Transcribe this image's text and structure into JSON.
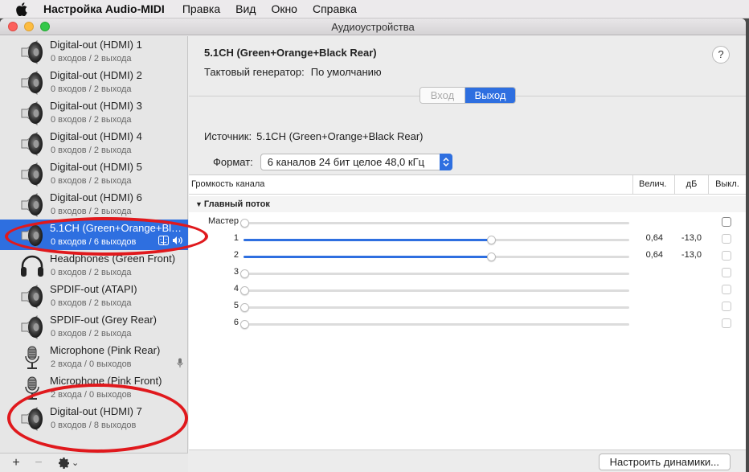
{
  "menubar": {
    "app": "Настройка Audio-MIDI",
    "items": [
      "Правка",
      "Вид",
      "Окно",
      "Справка"
    ]
  },
  "window": {
    "title": "Аудиоустройства"
  },
  "devices": [
    {
      "name": "Digital-out (HDMI) 1",
      "io": "0 входов / 2 выхода",
      "icon": "speaker-icon"
    },
    {
      "name": "Digital-out (HDMI) 2",
      "io": "0 входов / 2 выхода",
      "icon": "speaker-icon"
    },
    {
      "name": "Digital-out (HDMI) 3",
      "io": "0 входов / 2 выхода",
      "icon": "speaker-icon"
    },
    {
      "name": "Digital-out (HDMI) 4",
      "io": "0 входов / 2 выхода",
      "icon": "speaker-icon"
    },
    {
      "name": "Digital-out (HDMI) 5",
      "io": "0 входов / 2 выхода",
      "icon": "speaker-icon"
    },
    {
      "name": "Digital-out (HDMI) 6",
      "io": "0 входов / 2 выхода",
      "icon": "speaker-icon"
    },
    {
      "name": "5.1CH (Green+Orange+Black Rear)",
      "io": "0 входов / 6 выходов",
      "icon": "speaker-icon",
      "selected": true
    },
    {
      "name": "Headphones (Green Front)",
      "io": "0 входов / 2 выхода",
      "icon": "headphones-icon"
    },
    {
      "name": "SPDIF-out (ATAPI)",
      "io": "0 входов / 2 выхода",
      "icon": "speaker-icon"
    },
    {
      "name": "SPDIF-out (Grey Rear)",
      "io": "0 входов / 2 выхода",
      "icon": "speaker-icon"
    },
    {
      "name": "Microphone (Pink Rear)",
      "io": "2 входа / 0 выходов",
      "icon": "microphone-icon",
      "mic_badge": true
    },
    {
      "name": "Microphone (Pink Front)",
      "io": "2 входа / 0 выходов",
      "icon": "microphone-icon"
    },
    {
      "name": "Digital-out (HDMI) 7",
      "io": "0 входов / 8 выходов",
      "icon": "speaker-icon"
    }
  ],
  "sidebar_bottom": {
    "add": "+",
    "remove": "−",
    "gear_chevron": "⌄"
  },
  "detail": {
    "title": "5.1CH (Green+Orange+Black Rear)",
    "clock_label": "Тактовый генератор:",
    "clock_value": "По умолчанию",
    "help": "?",
    "tabs": {
      "input": "Вход",
      "output": "Выход",
      "active": "output"
    },
    "source_label": "Источник:",
    "source_value": "5.1CH (Green+Orange+Black Rear)",
    "format_label": "Формат:",
    "format_value": "6 каналов 24 бит целое 48,0 кГц",
    "table": {
      "col_channel": "Громкость канала",
      "col_value": "Велич.",
      "col_db": "дБ",
      "col_mute": "Выкл.",
      "group": "Главный поток",
      "rows": [
        {
          "label": "Мастер",
          "level": 0,
          "value": "",
          "db": "",
          "mute_enabled": true
        },
        {
          "label": "1",
          "level": 0.64,
          "value": "0,64",
          "db": "-13,0",
          "mute_enabled": false
        },
        {
          "label": "2",
          "level": 0.64,
          "value": "0,64",
          "db": "-13,0",
          "mute_enabled": false
        },
        {
          "label": "3",
          "level": 0,
          "value": "",
          "db": "",
          "mute_enabled": false
        },
        {
          "label": "4",
          "level": 0,
          "value": "",
          "db": "",
          "mute_enabled": false
        },
        {
          "label": "5",
          "level": 0,
          "value": "",
          "db": "",
          "mute_enabled": false
        },
        {
          "label": "6",
          "level": 0,
          "value": "",
          "db": "",
          "mute_enabled": false
        }
      ]
    },
    "configure_speakers": "Настроить динамики..."
  },
  "colors": {
    "accent": "#2e6fe0",
    "annotation": "#e0191d"
  }
}
